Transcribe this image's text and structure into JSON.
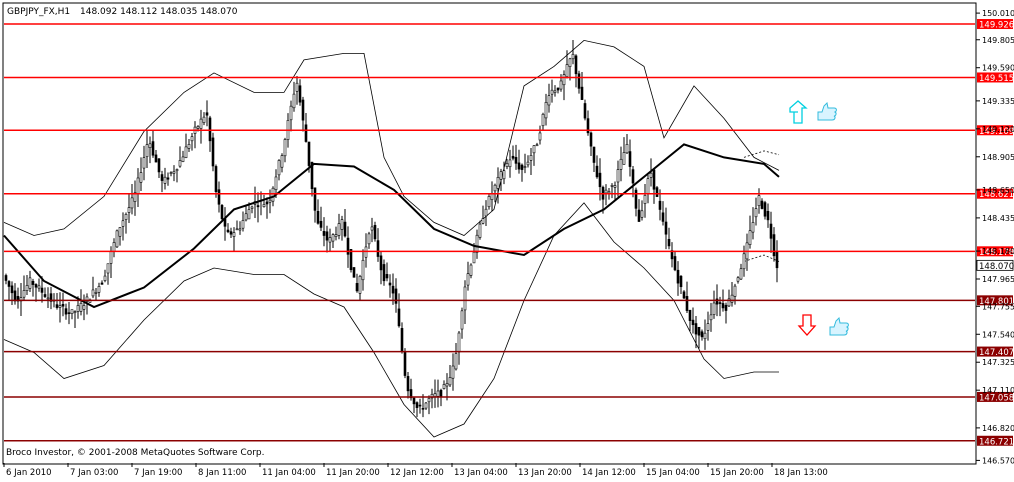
{
  "header": {
    "symbol": "GBPJPY_FX,H1",
    "ohlc": "148.092 148.112 148.035 148.070"
  },
  "copyright": "Broco Investor, © 2001-2008 MetaQuotes Software Corp.",
  "colors": {
    "background": "#ffffff",
    "frame": "#000000",
    "resistance_line": "#ff0000",
    "support_line": "#8b0000",
    "up_arrow": "#00d0e0",
    "down_arrow": "#ff0000",
    "thumb_icon": "#33bbdd"
  },
  "icons": [
    "up-arrow-icon",
    "down-arrow-icon",
    "thumbs-up-icon"
  ],
  "chart_data": {
    "type": "candlestick",
    "symbol": "GBPJPY_FX",
    "timeframe": "H1",
    "ylim": [
      146.55,
      150.08
    ],
    "y_ticks": [
      "150.010",
      "149.805",
      "149.590",
      "149.335",
      "149.120",
      "148.905",
      "148.650",
      "148.435",
      "148.180",
      "147.965",
      "147.755",
      "147.540",
      "147.325",
      "147.110",
      "146.820",
      "146.570"
    ],
    "x_ticks": [
      "6 Jan 2010",
      "7 Jan 03:00",
      "7 Jan 19:00",
      "8 Jan 11:00",
      "11 Jan 04:00",
      "11 Jan 20:00",
      "12 Jan 12:00",
      "13 Jan 04:00",
      "13 Jan 20:00",
      "14 Jan 12:00",
      "15 Jan 04:00",
      "15 Jan 20:00",
      "18 Jan 13:00"
    ],
    "current_price": "148.070",
    "levels": [
      {
        "label": "149.926",
        "value": 149.926,
        "kind": "resistance"
      },
      {
        "label": "149.515",
        "value": 149.515,
        "kind": "resistance"
      },
      {
        "label": "149.109",
        "value": 149.109,
        "kind": "resistance"
      },
      {
        "label": "148.621",
        "value": 148.621,
        "kind": "resistance"
      },
      {
        "label": "148.178",
        "value": 148.178,
        "kind": "resistance"
      },
      {
        "label": "147.801",
        "value": 147.801,
        "kind": "support"
      },
      {
        "label": "147.407",
        "value": 147.407,
        "kind": "support"
      },
      {
        "label": "147.058",
        "value": 147.058,
        "kind": "support"
      },
      {
        "label": "146.721",
        "value": 146.721,
        "kind": "support"
      }
    ],
    "price_path": [
      [
        0,
        148.0
      ],
      [
        14,
        147.8
      ],
      [
        28,
        147.95
      ],
      [
        42,
        147.85
      ],
      [
        56,
        147.75
      ],
      [
        70,
        147.7
      ],
      [
        84,
        147.8
      ],
      [
        100,
        147.95
      ],
      [
        116,
        148.35
      ],
      [
        132,
        148.6
      ],
      [
        146,
        149.05
      ],
      [
        160,
        148.7
      ],
      [
        176,
        148.85
      ],
      [
        192,
        149.1
      ],
      [
        204,
        149.25
      ],
      [
        214,
        148.6
      ],
      [
        224,
        148.3
      ],
      [
        236,
        148.35
      ],
      [
        250,
        148.55
      ],
      [
        266,
        148.55
      ],
      [
        280,
        148.95
      ],
      [
        294,
        149.5
      ],
      [
        304,
        149.0
      ],
      [
        314,
        148.4
      ],
      [
        326,
        148.25
      ],
      [
        340,
        148.4
      ],
      [
        354,
        147.85
      ],
      [
        368,
        148.4
      ],
      [
        380,
        148.0
      ],
      [
        392,
        147.85
      ],
      [
        404,
        147.15
      ],
      [
        416,
        146.95
      ],
      [
        428,
        147.05
      ],
      [
        440,
        147.1
      ],
      [
        452,
        147.3
      ],
      [
        462,
        147.9
      ],
      [
        472,
        148.2
      ],
      [
        482,
        148.5
      ],
      [
        494,
        148.7
      ],
      [
        508,
        148.9
      ],
      [
        520,
        148.8
      ],
      [
        534,
        149.0
      ],
      [
        546,
        149.4
      ],
      [
        558,
        149.45
      ],
      [
        570,
        149.7
      ],
      [
        580,
        149.3
      ],
      [
        590,
        148.9
      ],
      [
        600,
        148.6
      ],
      [
        612,
        148.7
      ],
      [
        624,
        149.0
      ],
      [
        636,
        148.4
      ],
      [
        648,
        148.8
      ],
      [
        660,
        148.4
      ],
      [
        670,
        148.1
      ],
      [
        680,
        147.85
      ],
      [
        690,
        147.6
      ],
      [
        700,
        147.5
      ],
      [
        712,
        147.8
      ],
      [
        724,
        147.75
      ],
      [
        734,
        147.95
      ],
      [
        744,
        148.2
      ],
      [
        756,
        148.6
      ],
      [
        766,
        148.4
      ],
      [
        774,
        148.07
      ]
    ],
    "moving_average": [
      [
        0,
        148.3
      ],
      [
        40,
        147.95
      ],
      [
        90,
        147.75
      ],
      [
        140,
        147.9
      ],
      [
        190,
        148.2
      ],
      [
        230,
        148.5
      ],
      [
        270,
        148.6
      ],
      [
        310,
        148.85
      ],
      [
        350,
        148.83
      ],
      [
        390,
        148.65
      ],
      [
        430,
        148.35
      ],
      [
        470,
        148.22
      ],
      [
        520,
        148.15
      ],
      [
        560,
        148.35
      ],
      [
        600,
        148.5
      ],
      [
        640,
        148.75
      ],
      [
        680,
        149.0
      ],
      [
        720,
        148.9
      ],
      [
        760,
        148.85
      ],
      [
        775,
        148.75
      ]
    ],
    "bollinger_upper": [
      [
        0,
        148.4
      ],
      [
        30,
        148.3
      ],
      [
        60,
        148.35
      ],
      [
        100,
        148.6
      ],
      [
        140,
        149.1
      ],
      [
        180,
        149.4
      ],
      [
        210,
        149.55
      ],
      [
        250,
        149.4
      ],
      [
        280,
        149.4
      ],
      [
        300,
        149.65
      ],
      [
        340,
        149.7
      ],
      [
        360,
        149.7
      ],
      [
        380,
        148.9
      ],
      [
        400,
        148.6
      ],
      [
        430,
        148.4
      ],
      [
        460,
        148.3
      ],
      [
        490,
        148.5
      ],
      [
        520,
        149.45
      ],
      [
        550,
        149.6
      ],
      [
        580,
        149.8
      ],
      [
        610,
        149.75
      ],
      [
        640,
        149.6
      ],
      [
        660,
        149.05
      ],
      [
        690,
        149.45
      ],
      [
        720,
        149.2
      ],
      [
        750,
        148.9
      ],
      [
        775,
        148.8
      ]
    ],
    "bollinger_lower": [
      [
        0,
        147.5
      ],
      [
        30,
        147.4
      ],
      [
        60,
        147.2
      ],
      [
        100,
        147.3
      ],
      [
        140,
        147.65
      ],
      [
        180,
        147.95
      ],
      [
        210,
        148.05
      ],
      [
        250,
        148.0
      ],
      [
        280,
        148.0
      ],
      [
        310,
        147.85
      ],
      [
        340,
        147.75
      ],
      [
        370,
        147.4
      ],
      [
        400,
        147.0
      ],
      [
        430,
        146.75
      ],
      [
        460,
        146.85
      ],
      [
        490,
        147.2
      ],
      [
        520,
        147.8
      ],
      [
        550,
        148.3
      ],
      [
        580,
        148.55
      ],
      [
        610,
        148.25
      ],
      [
        640,
        148.05
      ],
      [
        670,
        147.8
      ],
      [
        700,
        147.35
      ],
      [
        720,
        147.2
      ],
      [
        750,
        147.25
      ],
      [
        775,
        147.25
      ]
    ],
    "bollinger_upper_dotted": [
      [
        740,
        148.9
      ],
      [
        760,
        148.95
      ],
      [
        775,
        148.92
      ]
    ],
    "bollinger_lower_dotted": [
      [
        740,
        148.1
      ],
      [
        760,
        148.15
      ],
      [
        775,
        148.1
      ]
    ]
  }
}
